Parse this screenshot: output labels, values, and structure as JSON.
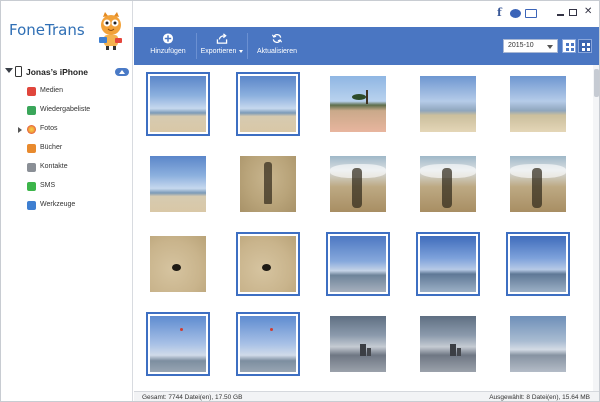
{
  "app": {
    "title": "FoneTrans"
  },
  "window_controls": {
    "facebook": "f",
    "close": "✕"
  },
  "device": {
    "name": "Jonas’s iPhone"
  },
  "sidebar": {
    "items": [
      {
        "label": "Medien",
        "icon": "music-icon",
        "color": "#e0463c"
      },
      {
        "label": "Wiedergabeliste",
        "icon": "playlist-icon",
        "color": "#3aa65a"
      },
      {
        "label": "Fotos",
        "icon": "photos-icon",
        "color": "#f0a13a"
      },
      {
        "label": "Bücher",
        "icon": "books-icon",
        "color": "#e88a2e"
      },
      {
        "label": "Kontakte",
        "icon": "contacts-icon",
        "color": "#8a8f96"
      },
      {
        "label": "SMS",
        "icon": "sms-icon",
        "color": "#3cb54a"
      },
      {
        "label": "Werkzeuge",
        "icon": "tools-icon",
        "color": "#3e7fd1"
      }
    ]
  },
  "toolbar": {
    "add_label": "Hinzufügen",
    "export_label": "Exportieren",
    "refresh_label": "Aktualisieren",
    "date_filter": "2015-10"
  },
  "photos": [
    {
      "style": "t-sky-beach",
      "selected": true
    },
    {
      "style": "t-sky-beach",
      "selected": true
    },
    {
      "style": "t-palms",
      "selected": false
    },
    {
      "style": "t-sky-beach2",
      "selected": false
    },
    {
      "style": "t-sky-beach2",
      "selected": false
    },
    {
      "style": "t-sky-beach",
      "selected": false
    },
    {
      "style": "t-shadow",
      "selected": false
    },
    {
      "style": "t-wave-shadow",
      "selected": false
    },
    {
      "style": "t-wave-shadow",
      "selected": false
    },
    {
      "style": "t-wave-shadow",
      "selected": false
    },
    {
      "style": "t-sand",
      "selected": false
    },
    {
      "style": "t-sand",
      "selected": true
    },
    {
      "style": "t-sea-blue",
      "selected": true
    },
    {
      "style": "t-sea-blue2",
      "selected": true
    },
    {
      "style": "t-sea-blue2",
      "selected": true
    },
    {
      "style": "t-kite",
      "selected": true
    },
    {
      "style": "t-kite",
      "selected": true
    },
    {
      "style": "t-storm",
      "selected": false
    },
    {
      "style": "t-storm",
      "selected": false
    },
    {
      "style": "t-calm",
      "selected": false
    }
  ],
  "status": {
    "total": "Gesamt: 7744 Datei(en), 17.50 GB",
    "selected": "Ausgewählt: 8 Datei(en), 15.64 MB"
  },
  "colors": {
    "toolbar": "#4a76c2",
    "accent": "#2f6fb5",
    "selection": "#3e6fc2"
  }
}
